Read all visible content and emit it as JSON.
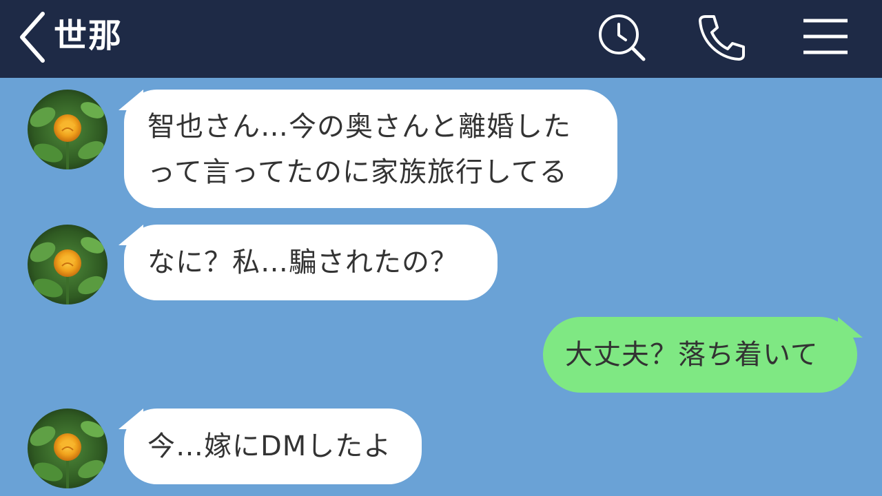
{
  "header": {
    "title": "世那",
    "back_icon": "chevron-left-icon",
    "search_icon": "search-clock-icon",
    "call_icon": "phone-icon",
    "menu_icon": "hamburger-menu-icon"
  },
  "colors": {
    "header_bg": "#1e2a46",
    "chat_bg": "#6aa2d6",
    "incoming_bubble": "#ffffff",
    "outgoing_bubble": "#7fe883"
  },
  "messages": [
    {
      "side": "left",
      "lines": [
        "智也さん…今の奥さんと離婚した",
        "って言ってたのに家族旅行してる"
      ]
    },
    {
      "side": "left",
      "lines": [
        "なに？私…騙されたの？"
      ]
    },
    {
      "side": "right",
      "lines": [
        "大丈夫？落ち着いて"
      ]
    },
    {
      "side": "left",
      "lines": [
        "今…嫁にDMしたよ"
      ]
    }
  ]
}
